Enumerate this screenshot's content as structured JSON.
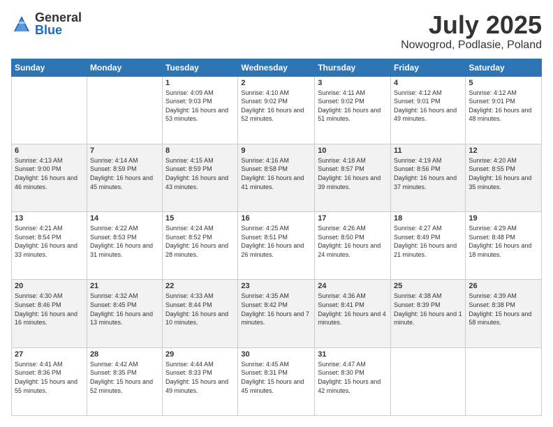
{
  "logo": {
    "general": "General",
    "blue": "Blue"
  },
  "title": "July 2025",
  "subtitle": "Nowogrod, Podlasie, Poland",
  "headers": [
    "Sunday",
    "Monday",
    "Tuesday",
    "Wednesday",
    "Thursday",
    "Friday",
    "Saturday"
  ],
  "weeks": [
    [
      {
        "day": "",
        "info": ""
      },
      {
        "day": "",
        "info": ""
      },
      {
        "day": "1",
        "info": "Sunrise: 4:09 AM\nSunset: 9:03 PM\nDaylight: 16 hours and 53 minutes."
      },
      {
        "day": "2",
        "info": "Sunrise: 4:10 AM\nSunset: 9:02 PM\nDaylight: 16 hours and 52 minutes."
      },
      {
        "day": "3",
        "info": "Sunrise: 4:11 AM\nSunset: 9:02 PM\nDaylight: 16 hours and 51 minutes."
      },
      {
        "day": "4",
        "info": "Sunrise: 4:12 AM\nSunset: 9:01 PM\nDaylight: 16 hours and 49 minutes."
      },
      {
        "day": "5",
        "info": "Sunrise: 4:12 AM\nSunset: 9:01 PM\nDaylight: 16 hours and 48 minutes."
      }
    ],
    [
      {
        "day": "6",
        "info": "Sunrise: 4:13 AM\nSunset: 9:00 PM\nDaylight: 16 hours and 46 minutes."
      },
      {
        "day": "7",
        "info": "Sunrise: 4:14 AM\nSunset: 8:59 PM\nDaylight: 16 hours and 45 minutes."
      },
      {
        "day": "8",
        "info": "Sunrise: 4:15 AM\nSunset: 8:59 PM\nDaylight: 16 hours and 43 minutes."
      },
      {
        "day": "9",
        "info": "Sunrise: 4:16 AM\nSunset: 8:58 PM\nDaylight: 16 hours and 41 minutes."
      },
      {
        "day": "10",
        "info": "Sunrise: 4:18 AM\nSunset: 8:57 PM\nDaylight: 16 hours and 39 minutes."
      },
      {
        "day": "11",
        "info": "Sunrise: 4:19 AM\nSunset: 8:56 PM\nDaylight: 16 hours and 37 minutes."
      },
      {
        "day": "12",
        "info": "Sunrise: 4:20 AM\nSunset: 8:55 PM\nDaylight: 16 hours and 35 minutes."
      }
    ],
    [
      {
        "day": "13",
        "info": "Sunrise: 4:21 AM\nSunset: 8:54 PM\nDaylight: 16 hours and 33 minutes."
      },
      {
        "day": "14",
        "info": "Sunrise: 4:22 AM\nSunset: 8:53 PM\nDaylight: 16 hours and 31 minutes."
      },
      {
        "day": "15",
        "info": "Sunrise: 4:24 AM\nSunset: 8:52 PM\nDaylight: 16 hours and 28 minutes."
      },
      {
        "day": "16",
        "info": "Sunrise: 4:25 AM\nSunset: 8:51 PM\nDaylight: 16 hours and 26 minutes."
      },
      {
        "day": "17",
        "info": "Sunrise: 4:26 AM\nSunset: 8:50 PM\nDaylight: 16 hours and 24 minutes."
      },
      {
        "day": "18",
        "info": "Sunrise: 4:27 AM\nSunset: 8:49 PM\nDaylight: 16 hours and 21 minutes."
      },
      {
        "day": "19",
        "info": "Sunrise: 4:29 AM\nSunset: 8:48 PM\nDaylight: 16 hours and 18 minutes."
      }
    ],
    [
      {
        "day": "20",
        "info": "Sunrise: 4:30 AM\nSunset: 8:46 PM\nDaylight: 16 hours and 16 minutes."
      },
      {
        "day": "21",
        "info": "Sunrise: 4:32 AM\nSunset: 8:45 PM\nDaylight: 16 hours and 13 minutes."
      },
      {
        "day": "22",
        "info": "Sunrise: 4:33 AM\nSunset: 8:44 PM\nDaylight: 16 hours and 10 minutes."
      },
      {
        "day": "23",
        "info": "Sunrise: 4:35 AM\nSunset: 8:42 PM\nDaylight: 16 hours and 7 minutes."
      },
      {
        "day": "24",
        "info": "Sunrise: 4:36 AM\nSunset: 8:41 PM\nDaylight: 16 hours and 4 minutes."
      },
      {
        "day": "25",
        "info": "Sunrise: 4:38 AM\nSunset: 8:39 PM\nDaylight: 16 hours and 1 minute."
      },
      {
        "day": "26",
        "info": "Sunrise: 4:39 AM\nSunset: 8:38 PM\nDaylight: 15 hours and 58 minutes."
      }
    ],
    [
      {
        "day": "27",
        "info": "Sunrise: 4:41 AM\nSunset: 8:36 PM\nDaylight: 15 hours and 55 minutes."
      },
      {
        "day": "28",
        "info": "Sunrise: 4:42 AM\nSunset: 8:35 PM\nDaylight: 15 hours and 52 minutes."
      },
      {
        "day": "29",
        "info": "Sunrise: 4:44 AM\nSunset: 8:33 PM\nDaylight: 15 hours and 49 minutes."
      },
      {
        "day": "30",
        "info": "Sunrise: 4:45 AM\nSunset: 8:31 PM\nDaylight: 15 hours and 45 minutes."
      },
      {
        "day": "31",
        "info": "Sunrise: 4:47 AM\nSunset: 8:30 PM\nDaylight: 15 hours and 42 minutes."
      },
      {
        "day": "",
        "info": ""
      },
      {
        "day": "",
        "info": ""
      }
    ]
  ]
}
